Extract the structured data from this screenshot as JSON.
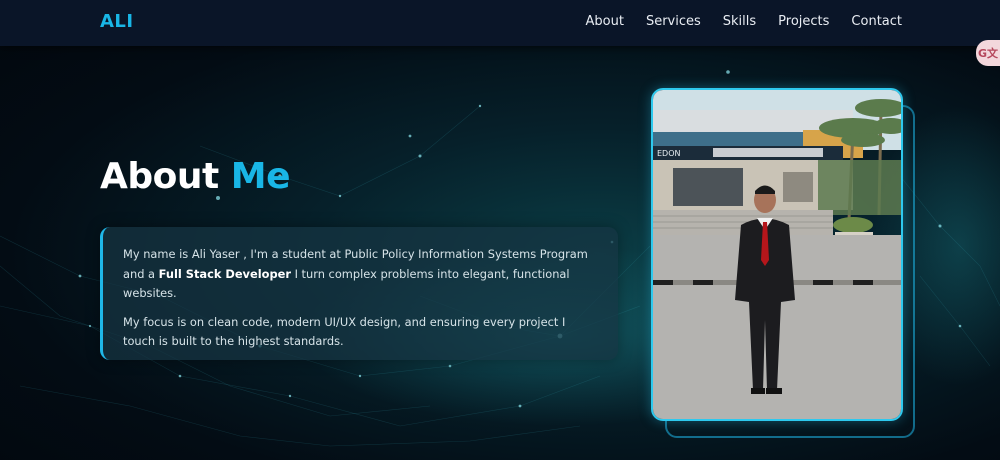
{
  "nav": {
    "logo": "ALI",
    "links": [
      "About",
      "Services",
      "Skills",
      "Projects",
      "Contact"
    ]
  },
  "hero": {
    "title_main": "About",
    "title_accent": "Me",
    "para1_part1": "My name is Ali Yaser , I'm a student at Public Policy Information Systems Program and a ",
    "para1_bold": "Full Stack Developer",
    "para1_part2": " I turn complex problems into elegant, functional websites.",
    "para2": "My focus is on clean code, modern UI/UX design, and ensuring every project I touch is built to the highest standards."
  },
  "photo": {
    "building_sign": "EDON"
  },
  "widget": {
    "label": "G文"
  },
  "colors": {
    "accent": "#19b6e6",
    "navbar_bg": "#0a1528",
    "page_bg": "#030c14",
    "frame_border": "#2ec9ee"
  }
}
